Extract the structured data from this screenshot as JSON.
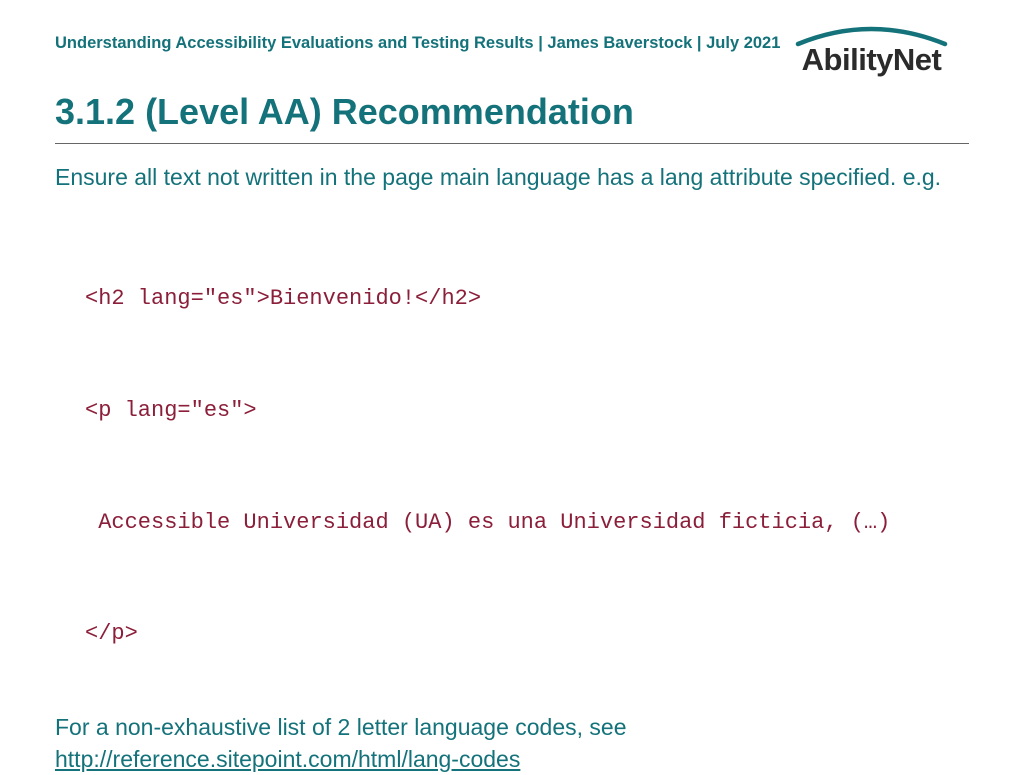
{
  "header": {
    "breadcrumb": "Understanding Accessibility Evaluations and Testing Results | James Baverstock | July 2021",
    "logo_text": "AbilityNet"
  },
  "title": "3.1.2 (Level AA) Recommendation",
  "intro": "Ensure all text not written in the page main language has a lang attribute specified. e.g.",
  "code": {
    "l1": "<h2 lang=\"es\">Bienvenido!</h2>",
    "l2": "<p lang=\"es\">",
    "l3": " Accessible Universidad (UA) es una Universidad ficticia, (…)",
    "l4": "</p>"
  },
  "outro_text": "For a non-exhaustive list of 2 letter language codes, see ",
  "outro_link": "http://reference.sitepoint.com/html/lang-codes"
}
